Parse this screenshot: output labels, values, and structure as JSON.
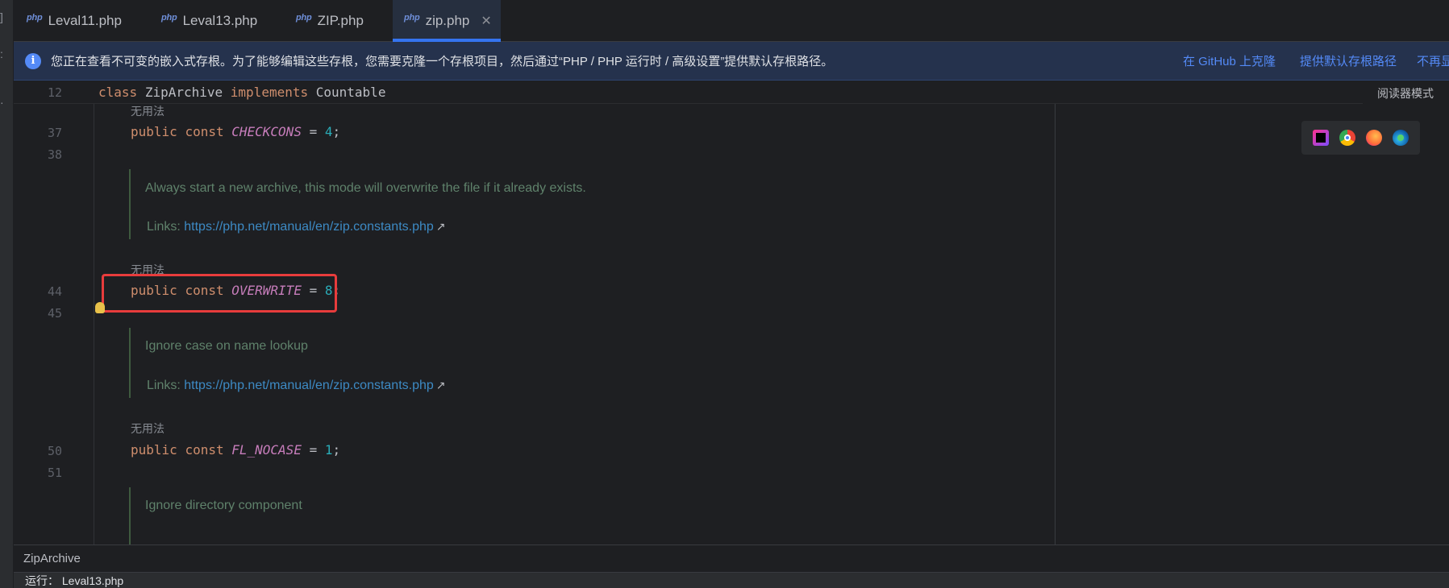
{
  "tabs": [
    {
      "icon": "php",
      "label": "Leval11.php",
      "active": false
    },
    {
      "icon": "php",
      "label": "Leval13.php",
      "active": false
    },
    {
      "icon": "php",
      "label": "ZIP.php",
      "active": false
    },
    {
      "icon": "php",
      "label": "zip.php",
      "active": true,
      "close": "✕"
    }
  ],
  "banner": {
    "icon": "info-icon",
    "message": "您正在查看不可变的嵌入式存根。为了能够编辑这些存根，您需要克隆一个存根项目，然后通过“PHP / PHP 运行时 / 高级设置”提供默认存根路径。",
    "actions": [
      "在 GitHub 上克隆",
      "提供默认存根路径",
      "不再显示"
    ]
  },
  "editor": {
    "sticky": {
      "line": "12",
      "kw1": "class",
      "name": "ZipArchive",
      "kw2": "implements",
      "iface": "Countable"
    },
    "reader_mode": "阅读器模式",
    "unused_hint": "无用法",
    "lines": {
      "l37": "37",
      "l38": "38",
      "l44": "44",
      "l45": "45",
      "l50": "50",
      "l51": "51"
    },
    "code": {
      "public": "public",
      "const": "const",
      "checkcons": "CHECKCONS",
      "checkcons_val": "4",
      "overwrite": "OVERWRITE",
      "overwrite_val": "8",
      "fl_nocase": "FL_NOCASE",
      "fl_nocase_val": "1",
      "eq": " = ",
      "semi": ";"
    },
    "docs": {
      "overwrite_doc": "Always start a new archive, this mode will overwrite the file if it already exists.",
      "nocase_doc": "Ignore case on name lookup",
      "nodir_doc": "Ignore directory component",
      "links_label": "Links:",
      "link_url": "https://php.net/manual/en/zip.constants.php",
      "link_arrow": "↗"
    }
  },
  "browser_icons": [
    "phpstorm-icon",
    "chrome-icon",
    "firefox-icon",
    "edge-icon"
  ],
  "breadcrumb": "ZipArchive",
  "runbar": "运行：   Leval13.php"
}
